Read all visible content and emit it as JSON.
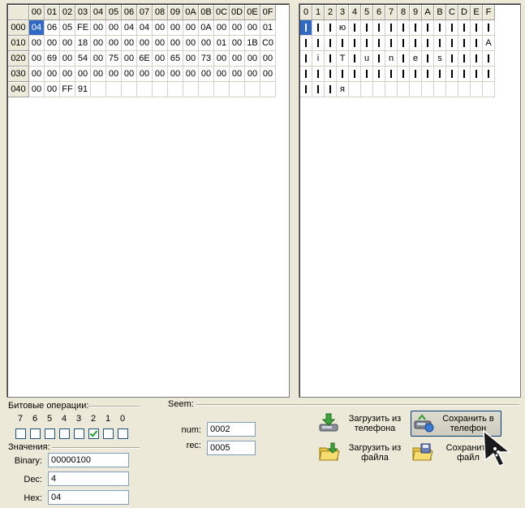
{
  "hex_grid": {
    "col_headers": [
      "00",
      "01",
      "02",
      "03",
      "04",
      "05",
      "06",
      "07",
      "08",
      "09",
      "0A",
      "0B",
      "0C",
      "0D",
      "0E",
      "0F"
    ],
    "rows": [
      {
        "offset": "000",
        "bytes": [
          "04",
          "06",
          "05",
          "FE",
          "00",
          "00",
          "04",
          "04",
          "00",
          "00",
          "00",
          "0A",
          "00",
          "00",
          "00",
          "01"
        ]
      },
      {
        "offset": "010",
        "bytes": [
          "00",
          "00",
          "00",
          "18",
          "00",
          "00",
          "00",
          "00",
          "00",
          "00",
          "00",
          "00",
          "01",
          "00",
          "1B",
          "C0"
        ]
      },
      {
        "offset": "020",
        "bytes": [
          "00",
          "69",
          "00",
          "54",
          "00",
          "75",
          "00",
          "6E",
          "00",
          "65",
          "00",
          "73",
          "00",
          "00",
          "00",
          "00"
        ]
      },
      {
        "offset": "030",
        "bytes": [
          "00",
          "00",
          "00",
          "00",
          "00",
          "00",
          "00",
          "00",
          "00",
          "00",
          "00",
          "00",
          "00",
          "00",
          "00",
          "00"
        ]
      },
      {
        "offset": "040",
        "bytes": [
          "00",
          "00",
          "FF",
          "91",
          "",
          "",
          "",
          "",
          "",
          "",
          "",
          "",
          "",
          "",
          "",
          ""
        ]
      }
    ],
    "selected": {
      "row": 0,
      "col": 0
    }
  },
  "char_grid": {
    "col_headers": [
      "0",
      "1",
      "2",
      "3",
      "4",
      "5",
      "6",
      "7",
      "8",
      "9",
      "A",
      "B",
      "C",
      "D",
      "E",
      "F"
    ],
    "rows": [
      [
        "|",
        "|",
        "|",
        "ю",
        "|",
        "|",
        "|",
        "|",
        "|",
        "|",
        "|",
        "|",
        "|",
        "|",
        "|",
        "|"
      ],
      [
        "|",
        "|",
        "|",
        "|",
        "|",
        "|",
        "|",
        "|",
        "|",
        "|",
        "|",
        "|",
        "|",
        "|",
        "|",
        "A"
      ],
      [
        "|",
        "i",
        "|",
        "T",
        "|",
        "u",
        "|",
        "n",
        "|",
        "e",
        "|",
        "s",
        "|",
        "|",
        "|",
        "|"
      ],
      [
        "|",
        "|",
        "|",
        "|",
        "|",
        "|",
        "|",
        "|",
        "|",
        "|",
        "|",
        "|",
        "|",
        "|",
        "|",
        "|"
      ],
      [
        "|",
        "|",
        "|",
        "я",
        "",
        "",
        "",
        "",
        "",
        "",
        "",
        "",
        "",
        "",
        "",
        ""
      ]
    ],
    "selected": {
      "row": 0,
      "col": 0
    }
  },
  "bit_ops": {
    "title": "Битовые операции:",
    "bits": [
      {
        "label": "7",
        "checked": false
      },
      {
        "label": "6",
        "checked": false
      },
      {
        "label": "5",
        "checked": false
      },
      {
        "label": "4",
        "checked": false
      },
      {
        "label": "3",
        "checked": false
      },
      {
        "label": "2",
        "checked": true
      },
      {
        "label": "1",
        "checked": false
      },
      {
        "label": "0",
        "checked": false
      }
    ]
  },
  "values": {
    "title": "Значения:",
    "binary_label": "Binary:",
    "binary_value": "00000100",
    "dec_label": "Dec:",
    "dec_value": "4",
    "hex_label": "Hex:",
    "hex_value": "04"
  },
  "seem": {
    "title": "Seem:",
    "num_label": "num:",
    "num_value": "0002",
    "rec_label": "rec:",
    "rec_value": "0005"
  },
  "buttons": {
    "load_phone": {
      "line1": "Загрузить из",
      "line2": "телефона",
      "icon": "phone-download-icon"
    },
    "save_phone": {
      "line1": "Сохранить в",
      "line2": "телефон",
      "icon": "phone-upload-icon"
    },
    "load_file": {
      "line1": "Загрузить из",
      "line2": "файла",
      "icon": "folder-open-icon"
    },
    "save_file": {
      "line1": "Сохранить",
      "line2": "файл",
      "icon": "folder-save-icon"
    }
  }
}
